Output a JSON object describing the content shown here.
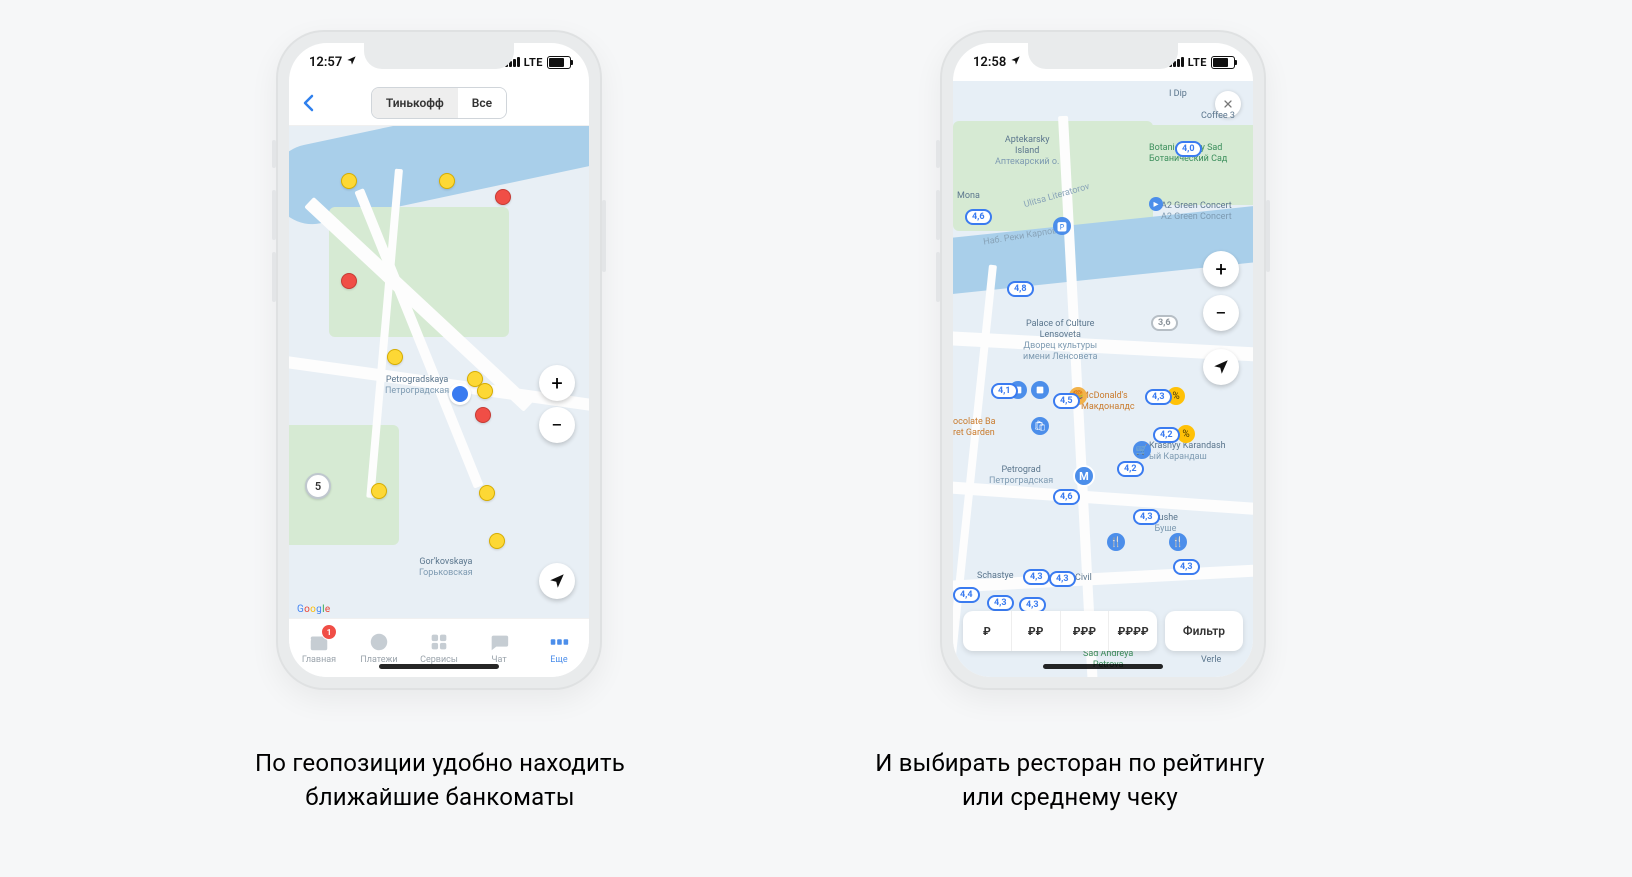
{
  "captions": {
    "left_l1": "По геопозиции удобно находить",
    "left_l2": "ближайшие банкоматы",
    "right_l1": "И выбирать ресторан по рейтингу",
    "right_l2": "или среднему чеку"
  },
  "phone1": {
    "status": {
      "time": "12:57",
      "net": "LTE"
    },
    "header": {
      "seg_a": "Тинькофф",
      "seg_b": "Все"
    },
    "map": {
      "station_en": "Petrogradskaya",
      "station_ru": "Петроградская",
      "station2_en": "Gor'kovskaya",
      "station2_ru": "Горьковская",
      "cluster": "5",
      "attribution": "Google"
    },
    "tabs": {
      "home": "Главная",
      "pay": "Платежи",
      "serv": "Сервисы",
      "chat": "Чат",
      "more": "Еще",
      "badge": "1"
    }
  },
  "phone2": {
    "status": {
      "time": "12:58",
      "net": "LTE"
    },
    "map": {
      "apt_en": "Aptekarsky",
      "apt_en2": "Island",
      "apt_ru": "Аптекарский о.",
      "mona": "Mona",
      "bot_en": "Botanicheskiy Sad",
      "bot_ru": "Ботанический Сад",
      "a2_en": "A2 Green Concert",
      "a2_ru": "A2 Green Concert",
      "palace_en": "Palace of Culture",
      "palace_en2": "Lensoveta",
      "palace_ru": "Дворец культуры",
      "palace_ru2": "имени Ленсовета",
      "mcd_en": "McDonald's",
      "mcd_ru": "Макдоналдс",
      "choco_en": "ocolate Ba",
      "choco_en2": "ret Garden",
      "petrograd_en": "Petrograd",
      "petrograd_ru": "Петроградская",
      "kras_en": "Krasnyy Karandash",
      "kras_ru": "ый Карандаш",
      "bushe_en": "Bushe",
      "bushe_ru": "Буше",
      "schastye_en": "Schastye",
      "civil_en": "Civil",
      "sad_en": "Sad Andreya",
      "sad_ru": "Petrova",
      "verle": "Verle",
      "coffee3": "Coffee 3",
      "idip": "I Dip",
      "r_street": "Ulitsa Literatorov",
      "r_emb": "Наб. Реки Карповки"
    },
    "ratings": [
      "4,6",
      "4,0",
      "4,8",
      "4,1",
      "4,5",
      "3,6",
      "4,3",
      "4,2",
      "4,2",
      "4,6",
      "4,3",
      "4,3",
      "4,3",
      "4,3",
      "4,4",
      "4,3",
      "4,3"
    ],
    "price": {
      "p1": "₽",
      "p2": "₽₽",
      "p3": "₽₽₽",
      "p4": "₽₽₽₽",
      "filter": "Фильтр"
    }
  }
}
